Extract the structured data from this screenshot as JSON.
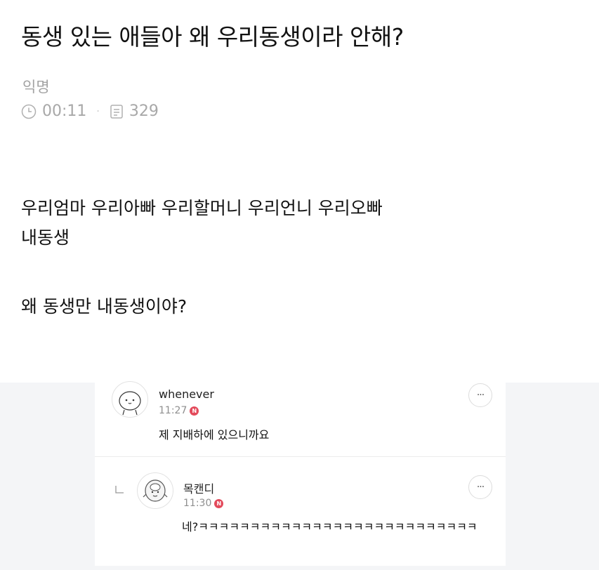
{
  "post": {
    "title": "동생 있는 애들아 왜 우리동생이라 안해?",
    "author": "익명",
    "time": "00:11",
    "views": "329",
    "paragraphs": [
      "우리엄마 우리아빠 우리할머니 우리언니 우리오빠",
      "내동생",
      "왜 동생만 내동생이야?"
    ]
  },
  "comments": [
    {
      "username": "whenever",
      "time": "11:27",
      "badge": "N",
      "text": "제 지배하에 있으니까요",
      "more": "···"
    },
    {
      "username": "목캔디",
      "time": "11:30",
      "badge": "N",
      "text": "네?ㅋㅋㅋㅋㅋㅋㅋㅋㅋㅋㅋㅋㅋㅋㅋㅋㅋㅋㅋㅋㅋㅋㅋㅋㅋㅋㅋ",
      "more": "···"
    }
  ],
  "icons": {
    "clock": "clock-icon",
    "views": "document-icon",
    "reply": "reply-arrow-icon",
    "avatar1": "character-avatar",
    "avatar2": "character-avatar"
  }
}
